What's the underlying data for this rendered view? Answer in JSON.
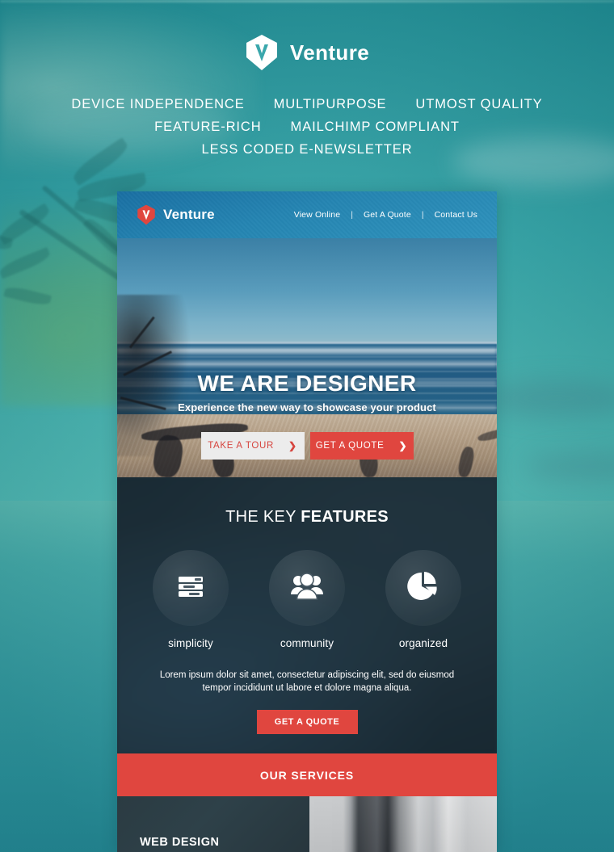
{
  "promo": {
    "logo_icon": "venture-shield-logo",
    "brand": "Venture",
    "feature_lines": [
      [
        "DEVICE INDEPENDENCE",
        "MULTIPURPOSE",
        "UTMOST QUALITY"
      ],
      [
        "FEATURE-RICH",
        "MAILCHIMP COMPLIANT"
      ],
      [
        "LESS CODED E-NEWSLETTER"
      ]
    ]
  },
  "email": {
    "header": {
      "logo_icon": "venture-shield-logo-red",
      "brand": "Venture",
      "nav": [
        {
          "label": "View Online"
        },
        {
          "label": "Get A Quote"
        },
        {
          "label": "Contact Us"
        }
      ],
      "separator": "|"
    },
    "hero": {
      "title": "WE ARE DESIGNER",
      "subtitle": "Experience the new way to showcase your product",
      "buttons": [
        {
          "label": "TAKE A TOUR",
          "icon": "chevron-right-icon",
          "style": "light"
        },
        {
          "label": "GET A QUOTE",
          "icon": "chevron-right-icon",
          "style": "red"
        }
      ]
    },
    "features": {
      "heading_light": "THE KEY ",
      "heading_bold": "FEATURES",
      "items": [
        {
          "label": "simplicity",
          "icon": "server-list-icon"
        },
        {
          "label": "community",
          "icon": "people-group-icon"
        },
        {
          "label": "organized",
          "icon": "pie-chart-icon"
        }
      ],
      "description": "Lorem ipsum dolor sit amet, consectetur adipiscing elit, sed do eiusmod tempor incididunt ut labore et dolore magna aliqua.",
      "cta_label": "GET A QUOTE"
    },
    "services": {
      "band_label": "OUR SERVICES",
      "first_item_title": "WEB DESIGN"
    }
  },
  "colors": {
    "accent_red": "#e0463f",
    "header_blue": "#2585b2",
    "dark_panel": "#2a3b45",
    "promo_teal": "#3aa7ac",
    "text_white": "#ffffff",
    "button_light": "#ececec"
  }
}
